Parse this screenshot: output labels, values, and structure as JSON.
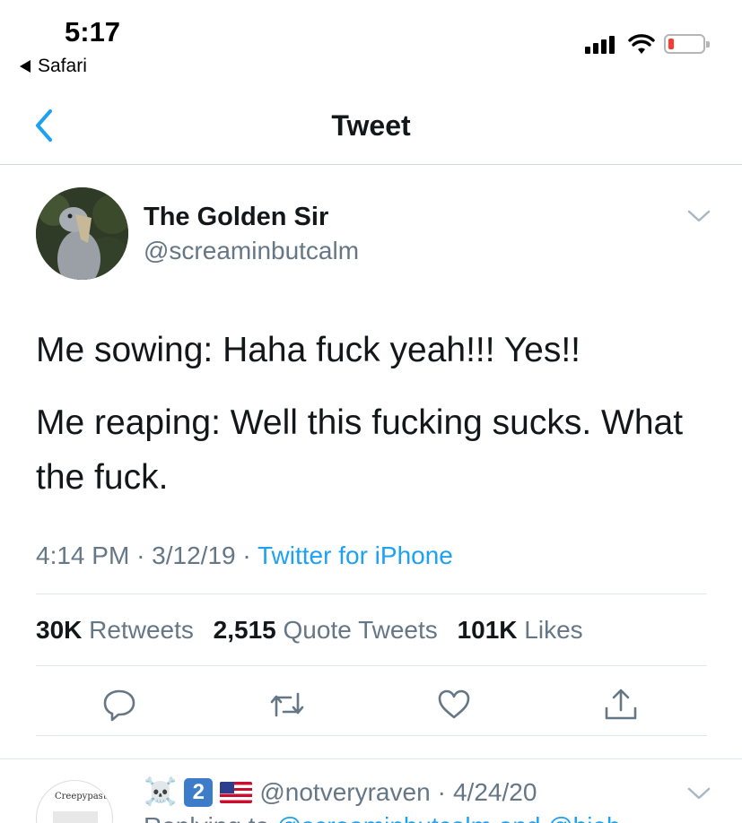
{
  "status_bar": {
    "time": "5:17",
    "back_app": "Safari",
    "battery_color": "#ff3b30"
  },
  "nav": {
    "title": "Tweet",
    "back_icon": "chevron-left-icon",
    "accent_color": "#1da1f2"
  },
  "tweet": {
    "author_name": "The Golden Sir",
    "author_handle": "@screaminbutcalm",
    "text_lines": [
      "Me sowing: Haha fuck yeah!!! Yes!!",
      "Me reaping: Well this fucking sucks. What the fuck."
    ],
    "time": "4:14 PM",
    "date": "3/12/19",
    "source": "Twitter for iPhone",
    "separator": "·",
    "stats": {
      "retweets_count": "30K",
      "retweets_label": "Retweets",
      "quotes_count": "2,515",
      "quotes_label": "Quote Tweets",
      "likes_count": "101K",
      "likes_label": "Likes"
    },
    "actions": [
      "reply-icon",
      "retweet-icon",
      "like-icon",
      "share-icon"
    ]
  },
  "reply": {
    "avatar_text": "Creepypasta.",
    "badge": "2",
    "handle": "@notveryraven",
    "date": "4/24/20",
    "text_prefix": "Replying to",
    "text_link": "@screaminbutcalm and @bieb"
  }
}
